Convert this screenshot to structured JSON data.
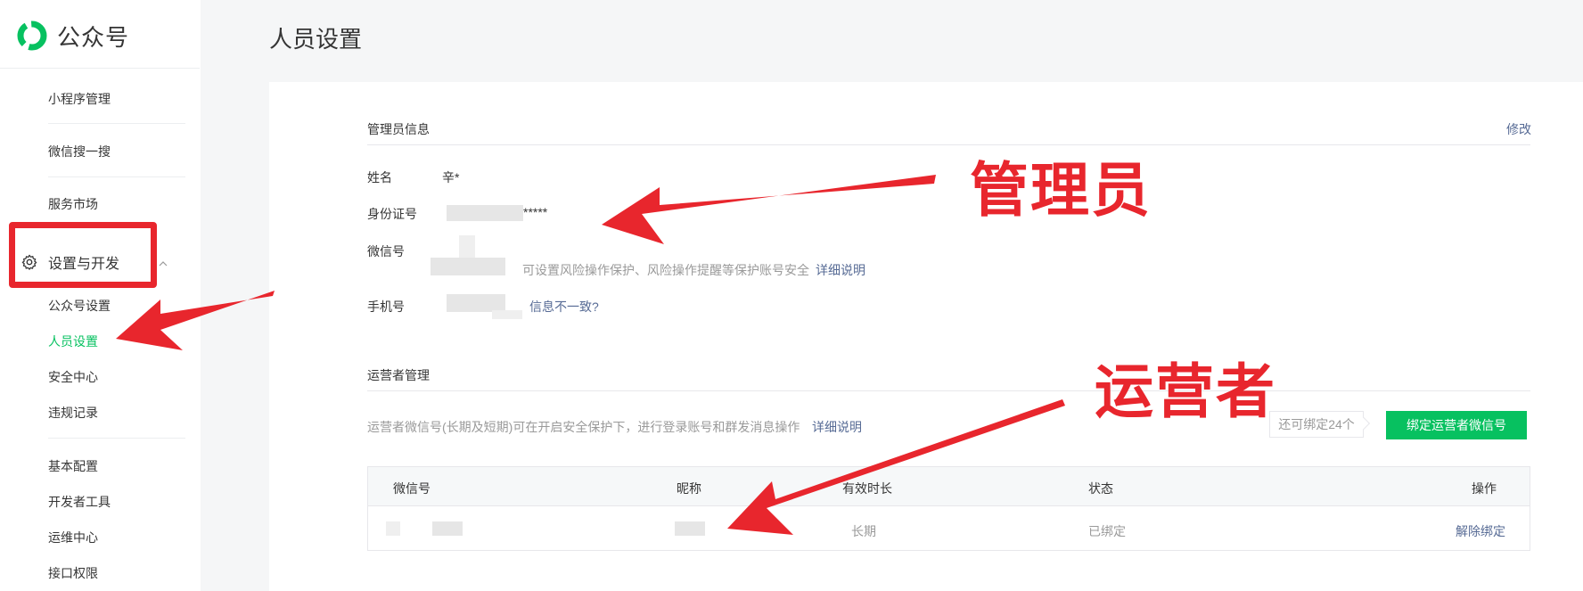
{
  "app": {
    "name": "公众号"
  },
  "sidebar": {
    "top_items": [
      {
        "label": "小程序管理"
      },
      {
        "label": "微信搜一搜"
      },
      {
        "label": "服务市场"
      }
    ],
    "group": {
      "label": "设置与开发",
      "items": [
        {
          "label": "公众号设置"
        },
        {
          "label": "人员设置",
          "active": true
        },
        {
          "label": "安全中心"
        },
        {
          "label": "违规记录"
        }
      ]
    },
    "bottom_items": [
      {
        "label": "基本配置"
      },
      {
        "label": "开发者工具"
      },
      {
        "label": "运维中心"
      },
      {
        "label": "接口权限"
      }
    ]
  },
  "page": {
    "title": "人员设置"
  },
  "admin": {
    "section_title": "管理员信息",
    "edit_label": "修改",
    "name_label": "姓名",
    "name_value": "辛*",
    "id_label": "身份证号",
    "id_value_suffix": "*****",
    "wechat_label": "微信号",
    "wechat_hint": "可设置风险操作保护、风险操作提醒等保护账号安全",
    "wechat_detail_link": "详细说明",
    "phone_label": "手机号",
    "phone_mismatch_link": "信息不一致?"
  },
  "operators": {
    "section_title": "运营者管理",
    "description": "运营者微信号(长期及短期)可在开启安全保护下，进行登录账号和群发消息操作",
    "detail_link": "详细说明",
    "quota_text": "还可绑定24个",
    "bind_button": "绑定运营者微信号",
    "table": {
      "headers": [
        "微信号",
        "昵称",
        "有效时长",
        "状态",
        "操作"
      ],
      "rows": [
        {
          "wechat_id": "",
          "nickname": "",
          "duration": "长期",
          "status": "已绑定",
          "action": "解除绑定"
        }
      ]
    }
  },
  "annotations": {
    "admin_label": "管理员",
    "operator_label": "运营者"
  },
  "colors": {
    "brand_green": "#07c160",
    "link_blue": "#576b95",
    "annotation_red": "#e8262d"
  }
}
